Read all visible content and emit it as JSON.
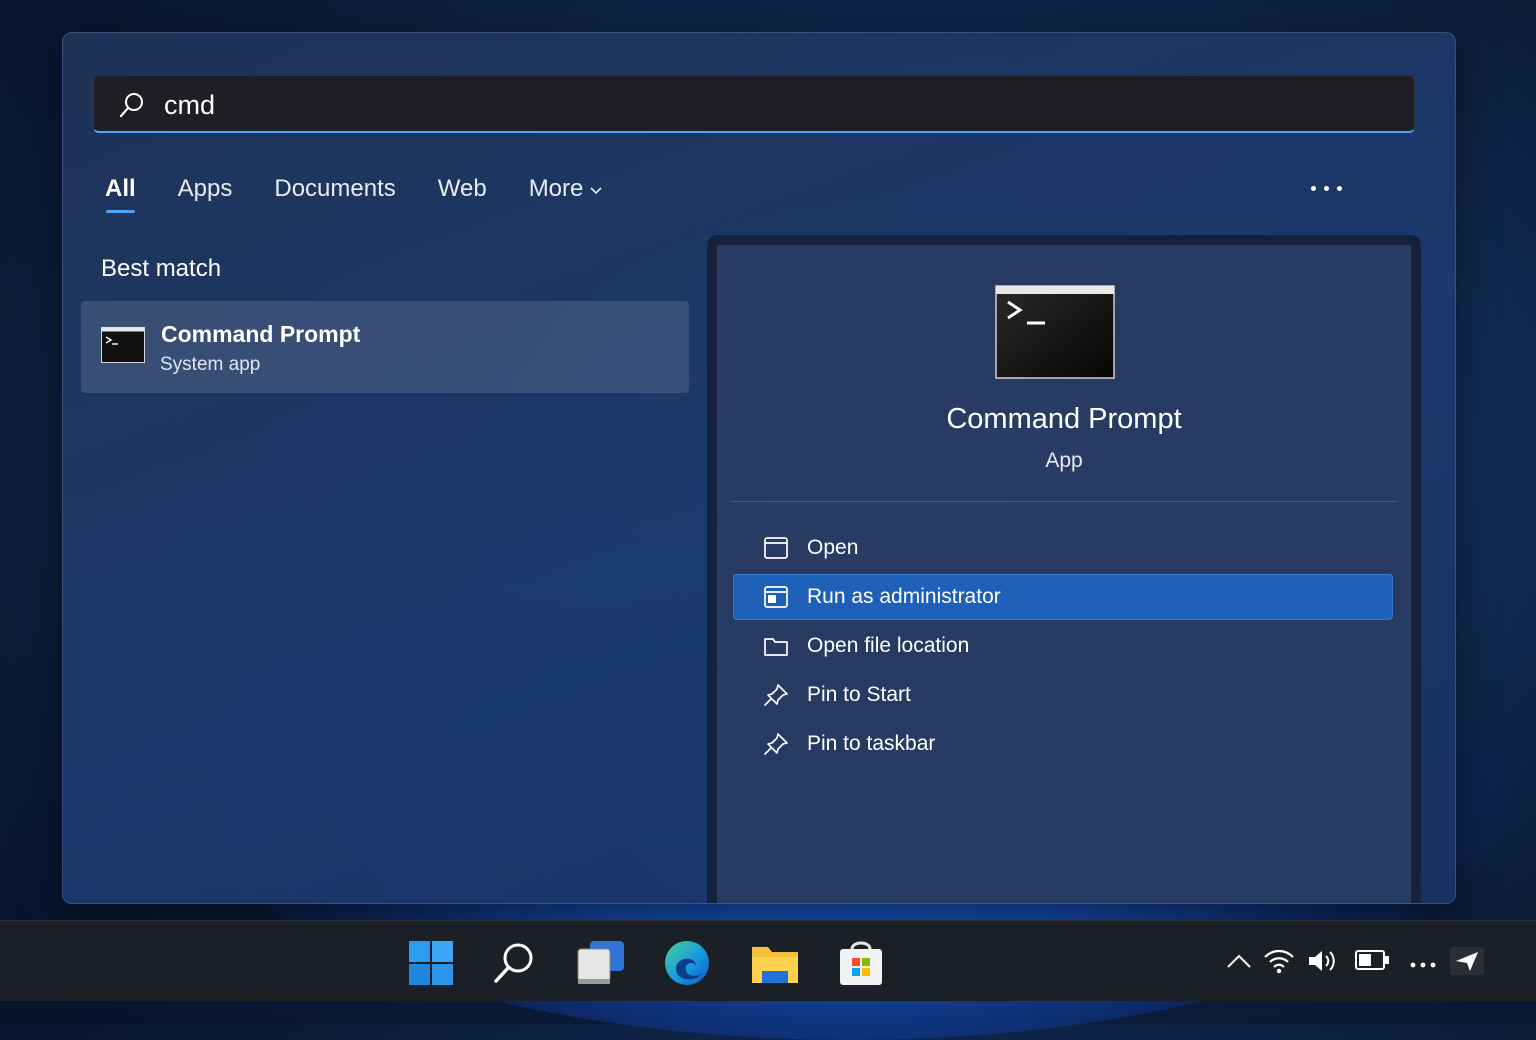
{
  "search": {
    "value": "cmd"
  },
  "tabs": [
    {
      "label": "All",
      "active": true
    },
    {
      "label": "Apps"
    },
    {
      "label": "Documents"
    },
    {
      "label": "Web"
    },
    {
      "label": "More"
    }
  ],
  "best_match": {
    "section_title": "Best match",
    "name": "Command Prompt",
    "type": "System app"
  },
  "detail": {
    "title": "Command Prompt",
    "subtitle": "App",
    "actions": [
      {
        "label": "Open",
        "icon": "window-icon"
      },
      {
        "label": "Run as administrator",
        "icon": "admin-window-icon",
        "highlighted": true
      },
      {
        "label": "Open file location",
        "icon": "folder-icon"
      },
      {
        "label": "Pin to Start",
        "icon": "pin-icon"
      },
      {
        "label": "Pin to taskbar",
        "icon": "pin-icon"
      }
    ]
  },
  "taskbar": {
    "apps": [
      "windows-start-icon",
      "search-icon",
      "task-view-icon",
      "edge-icon",
      "file-explorer-icon",
      "microsoft-store-icon"
    ],
    "tray": [
      "chevron-up-icon",
      "wifi-icon",
      "volume-icon",
      "battery-icon",
      "overflow-dots-icon",
      "notification-icon"
    ]
  },
  "colors": {
    "accent": "#4aa6ff",
    "highlight": "#1e5fb8",
    "taskbar": "#1b1f26"
  }
}
